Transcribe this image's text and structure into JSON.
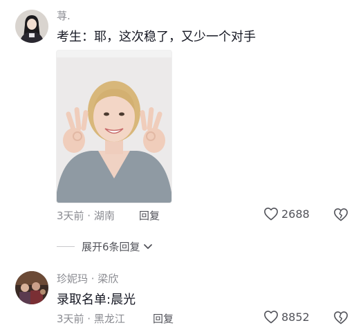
{
  "comments": [
    {
      "author": "荨.",
      "text": "考生：耶，这次稳了，又少一个对手",
      "time_location": "3天前 · 湖南",
      "reply_label": "回复",
      "likes": "2688"
    },
    {
      "author": "珍妮玛 · 梁欣",
      "text": "录取名单:晨光",
      "time_location": "3天前 · 黑龙江",
      "reply_label": "回复",
      "likes": "8852"
    }
  ],
  "expand_replies": {
    "label": "展开6条回复"
  },
  "icons": {
    "like": "heart-outline-icon",
    "dislike": "broken-heart-icon",
    "expand": "chevron-down-icon"
  }
}
